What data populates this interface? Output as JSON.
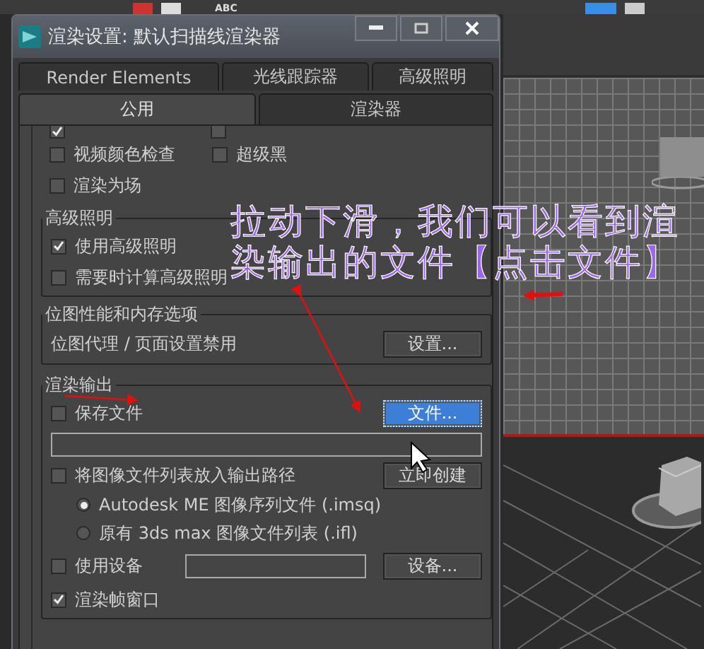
{
  "toolbar": {
    "label": "ABC"
  },
  "window": {
    "title": "渲染设置: 默认扫描线渲染器"
  },
  "tabs_row_1": [
    {
      "label": "Render Elements",
      "selected": false
    },
    {
      "label": "光线跟踪器",
      "selected": false
    },
    {
      "label": "高级照明",
      "selected": false
    }
  ],
  "tabs_row_2": [
    {
      "label": "公用",
      "selected": true
    },
    {
      "label": "渲染器",
      "selected": false
    }
  ],
  "partial_row": [
    {
      "checked": true
    },
    {
      "checked": false
    }
  ],
  "option_rows": [
    [
      {
        "label": "视频颜色检查",
        "checked": false
      },
      {
        "label": "超级黑",
        "checked": false
      }
    ],
    [
      {
        "label": "渲染为场",
        "checked": false
      }
    ]
  ],
  "advanced_lighting": {
    "title": "高级照明",
    "options": [
      {
        "label": "使用高级照明",
        "checked": true
      },
      {
        "label": "需要时计算高级照明",
        "checked": false
      }
    ]
  },
  "bitmap": {
    "title": "位图性能和内存选项",
    "text": "位图代理 / 页面设置禁用",
    "button": "设置..."
  },
  "render_output": {
    "title": "渲染输出",
    "save_file": {
      "label": "保存文件",
      "checked": false
    },
    "file_button": {
      "label": "文件...",
      "focused": true
    },
    "image_list": {
      "label": "将图像文件列表放入输出路径",
      "checked": false
    },
    "create_button": "立即创建",
    "formats": [
      {
        "label": "Autodesk ME 图像序列文件 (.imsq)",
        "selected": true
      },
      {
        "label": "原有 3ds max 图像文件列表 (.ifl)",
        "selected": false
      }
    ],
    "use_device": {
      "label": "使用设备",
      "checked": false
    },
    "device_button": "设备...",
    "frame_window": {
      "label": "渲染帧窗口",
      "checked": true
    }
  },
  "annotation": {
    "lines": [
      "拉动下滑，我们可以看到渲",
      "染输出的文件【点击文件】"
    ]
  }
}
